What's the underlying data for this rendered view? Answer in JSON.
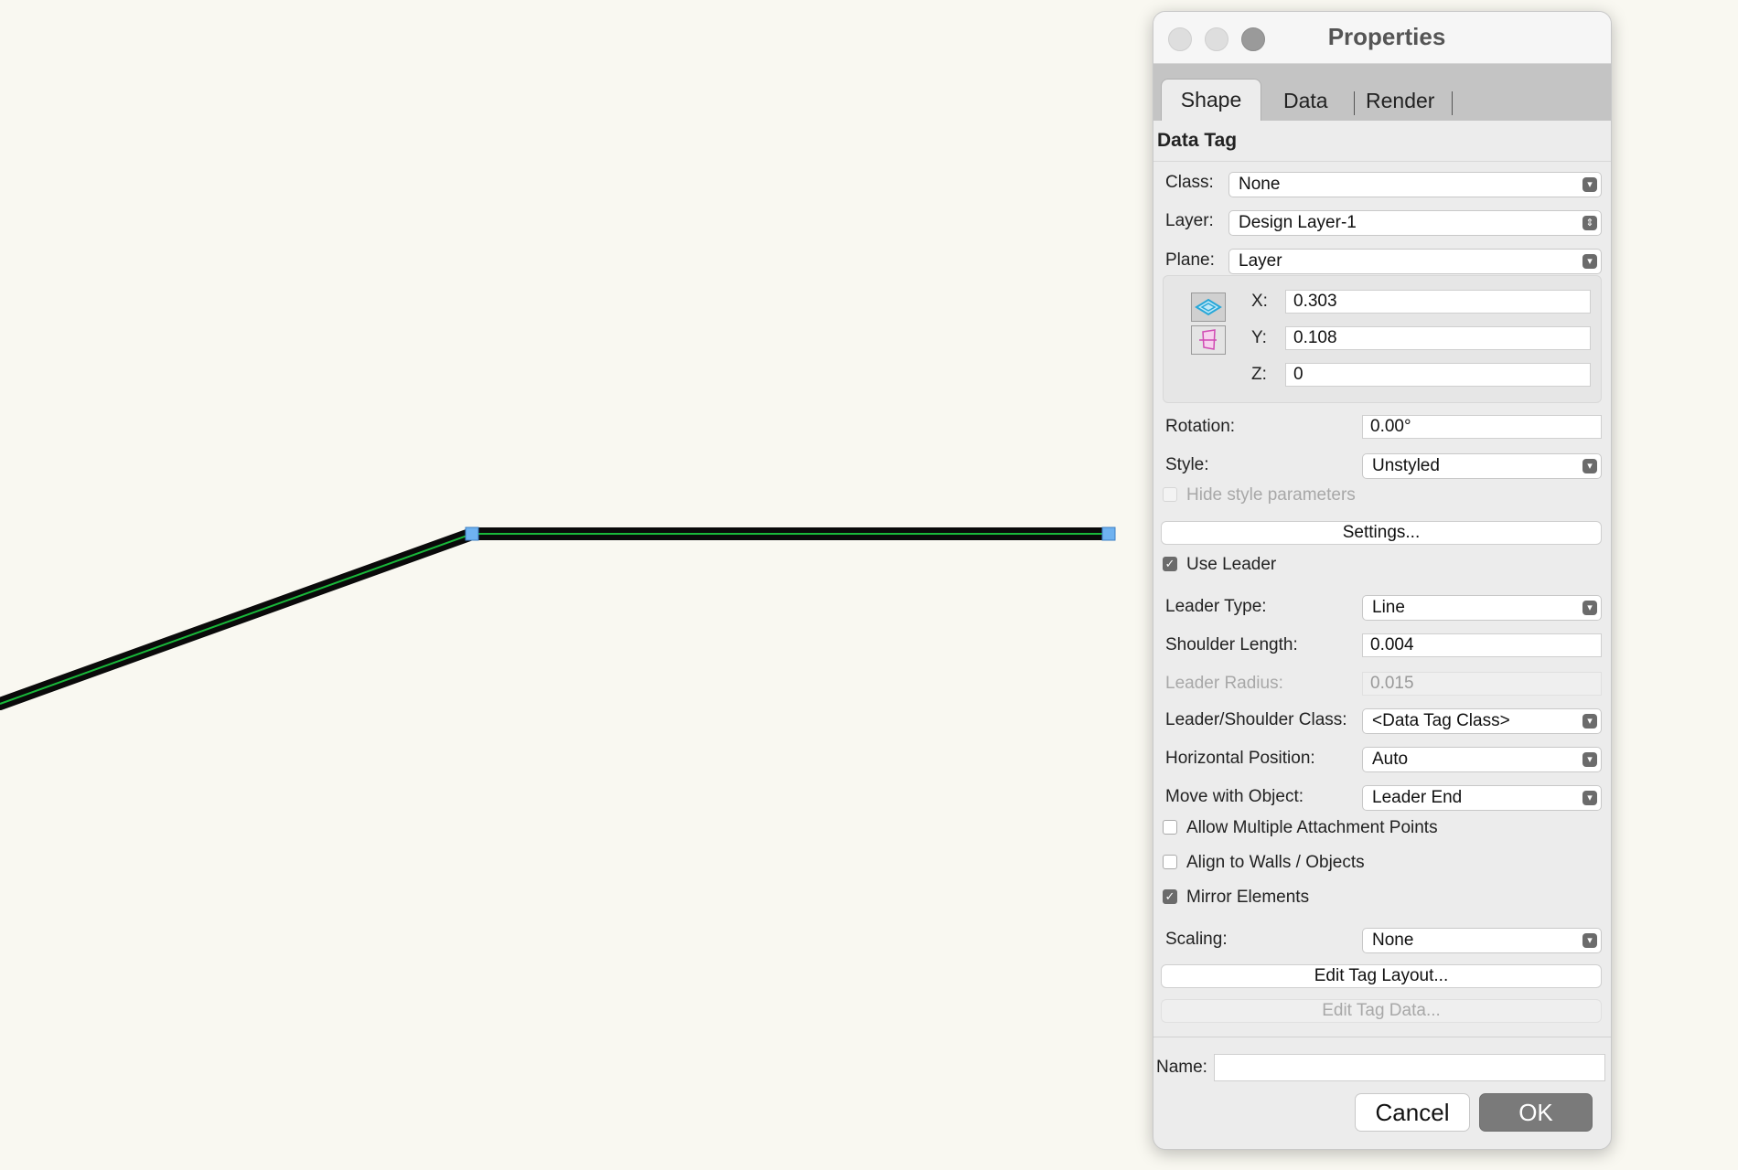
{
  "dialog": {
    "title": "Properties",
    "tabs": [
      "Shape",
      "Data",
      "Render"
    ],
    "section_title": "Data Tag",
    "class": {
      "label": "Class:",
      "value": "None"
    },
    "layer": {
      "label": "Layer:",
      "value": "Design Layer-1"
    },
    "plane": {
      "label": "Plane:",
      "value": "Layer"
    },
    "coords": {
      "x_label": "X:",
      "x_value": "0.303",
      "y_label": "Y:",
      "y_value": "0.108",
      "z_label": "Z:",
      "z_value": "0"
    },
    "rotation": {
      "label": "Rotation:",
      "value": "0.00°"
    },
    "style": {
      "label": "Style:",
      "value": "Unstyled"
    },
    "hide_style_params": "Hide style parameters",
    "settings_button": "Settings...",
    "use_leader": "Use Leader",
    "leader_type": {
      "label": "Leader Type:",
      "value": "Line"
    },
    "shoulder_length": {
      "label": "Shoulder Length:",
      "value": "0.004"
    },
    "leader_radius": {
      "label": "Leader Radius:",
      "value": "0.015"
    },
    "leader_shoulder_class": {
      "label": "Leader/Shoulder Class:",
      "value": "<Data Tag Class>"
    },
    "horizontal_position": {
      "label": "Horizontal Position:",
      "value": "Auto"
    },
    "move_with_object": {
      "label": "Move with Object:",
      "value": "Leader End"
    },
    "allow_multiple": "Allow Multiple Attachment Points",
    "align_to_walls": "Align to Walls / Objects",
    "mirror_elements": "Mirror Elements",
    "scaling": {
      "label": "Scaling:",
      "value": "None"
    },
    "edit_tag_layout": "Edit Tag Layout...",
    "edit_tag_data": "Edit Tag Data...",
    "name": {
      "label": "Name:",
      "value": ""
    },
    "cancel": "Cancel",
    "ok": "OK"
  },
  "colors": {
    "canvas_bg": "#f9f8f1",
    "leader_stroke": "#0a0a0a",
    "leader_highlight": "#19b83a",
    "handle": "#6fb2f0"
  }
}
